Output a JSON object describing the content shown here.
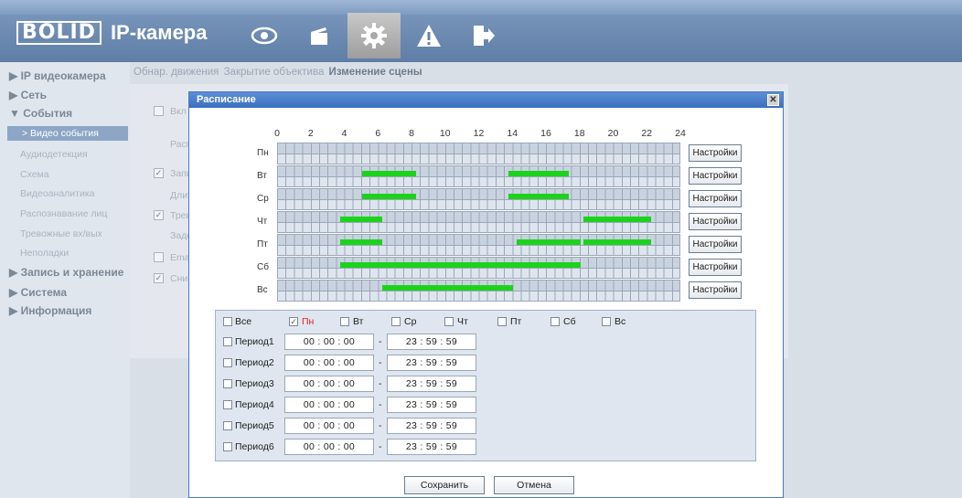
{
  "header": {
    "logo_brand": "BOLID",
    "logo_product": "IP-камера",
    "icons": [
      "eye-icon",
      "clapper-icon",
      "gear-icon",
      "warning-icon",
      "logout-icon"
    ]
  },
  "sidebar": {
    "groups": [
      {
        "label": "▶ IP видеокамера"
      },
      {
        "label": "▶ Сеть"
      },
      {
        "label": "▼ События"
      }
    ],
    "event_items": [
      "> Видео события",
      "Аудиодетекция",
      "Схема",
      "Видеоаналитика",
      "Распознавание лиц",
      "Тревожные вх/вых",
      "Неполадки"
    ],
    "groups_after": [
      {
        "label": "▶ Запись и хранение"
      },
      {
        "label": "▶ Система"
      },
      {
        "label": "▶ Информация"
      }
    ]
  },
  "tabs": [
    "Обнар. движения",
    "Закрытие объектива",
    "Изменение сцены"
  ],
  "background_form": {
    "rows": [
      "Вкл",
      "Расп",
      "Запи",
      "Длит",
      "Трев",
      "Заде",
      "Ema",
      "Сним"
    ]
  },
  "dialog": {
    "title": "Расписание",
    "close_icon": "close-icon",
    "hours": [
      "0",
      "2",
      "4",
      "6",
      "8",
      "10",
      "12",
      "14",
      "16",
      "18",
      "20",
      "22",
      "24"
    ],
    "days": [
      "Пн",
      "Вт",
      "Ср",
      "Чт",
      "Пт",
      "Сб",
      "Вс"
    ],
    "settings_label": "Настройки",
    "bar_color": "#1bd31b",
    "schedule": {
      "Пн": [],
      "Вт": [
        [
          5,
          8.2
        ],
        [
          13.7,
          17.3
        ]
      ],
      "Ср": [
        [
          5,
          8.2
        ],
        [
          13.7,
          17.3
        ]
      ],
      "Чт": [
        [
          3.7,
          6.2
        ],
        [
          18.2,
          22.2
        ]
      ],
      "Пт": [
        [
          3.7,
          6.2
        ],
        [
          14.2,
          18
        ],
        [
          18.2,
          22.2
        ]
      ],
      "Сб": [
        [
          3.7,
          18
        ]
      ],
      "Вс": [
        [
          6.2,
          14
        ]
      ]
    },
    "day_checks": {
      "all": "Все",
      "days": [
        {
          "label": "Пн",
          "checked": true
        },
        {
          "label": "Вт",
          "checked": false
        },
        {
          "label": "Ср",
          "checked": false
        },
        {
          "label": "Чт",
          "checked": false
        },
        {
          "label": "Пт",
          "checked": false
        },
        {
          "label": "Сб",
          "checked": false
        },
        {
          "label": "Вс",
          "checked": false
        }
      ]
    },
    "periods": [
      {
        "label": "Период1",
        "start": "00 :  00 :  00",
        "end": "23 :  59 :  59"
      },
      {
        "label": "Период2",
        "start": "00 :  00 :  00",
        "end": "23 :  59 :  59"
      },
      {
        "label": "Период3",
        "start": "00 :  00 :  00",
        "end": "23 :  59 :  59"
      },
      {
        "label": "Период4",
        "start": "00 :  00 :  00",
        "end": "23 :  59 :  59"
      },
      {
        "label": "Период5",
        "start": "00 :  00 :  00",
        "end": "23 :  59 :  59"
      },
      {
        "label": "Период6",
        "start": "00 :  00 :  00",
        "end": "23 :  59 :  59"
      }
    ],
    "save_label": "Сохранить",
    "cancel_label": "Отмена"
  }
}
